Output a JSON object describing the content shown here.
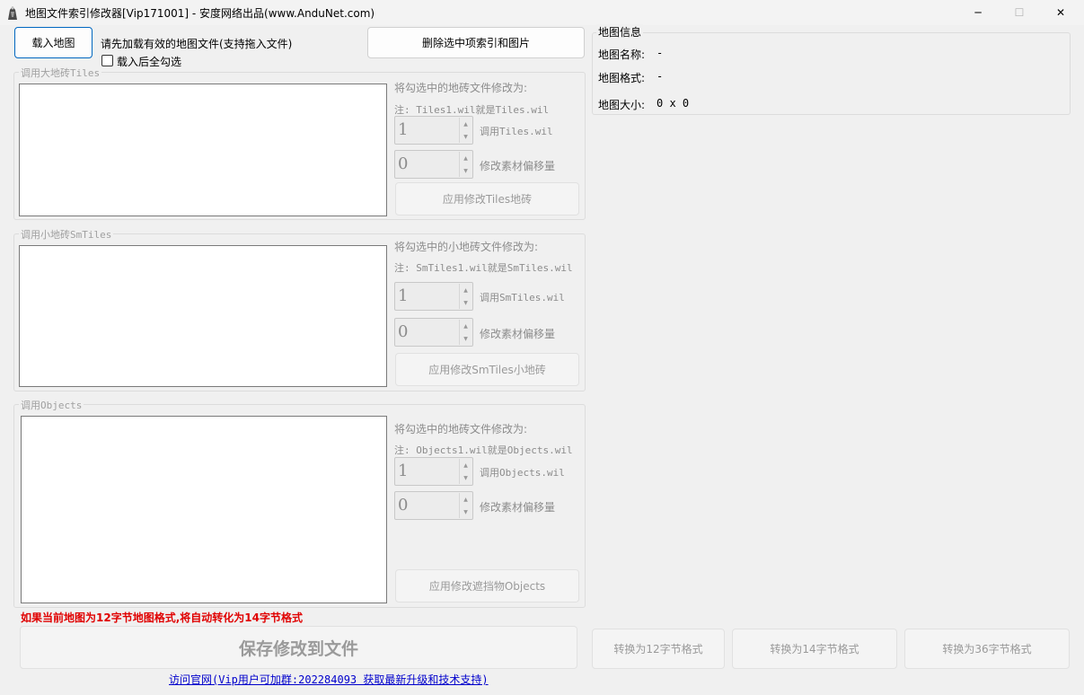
{
  "window": {
    "title": "地图文件索引修改器[Vip171001] - 安度网络出品(www.AnduNet.com)",
    "minimize_glyph": "─",
    "maximize_glyph": "☐",
    "close_glyph": "✕"
  },
  "toolbar": {
    "load_map_label": "载入地图",
    "hint_text": "请先加载有效的地图文件(支持拖入文件)",
    "select_all_after_load_label": "载入后全勾选",
    "delete_selected_label": "删除选中项索引和图片"
  },
  "tiles": {
    "group_title": "调用大地砖Tiles",
    "modify_title": "将勾选中的地砖文件修改为:",
    "note": "注: Tiles1.wil就是Tiles.wil",
    "index_value": "1",
    "index_label": "调用Tiles.wil",
    "offset_value": "0",
    "offset_label": "修改素材偏移量",
    "apply_label": "应用修改Tiles地砖"
  },
  "smtiles": {
    "group_title": "调用小地砖SmTiles",
    "modify_title": "将勾选中的小地砖文件修改为:",
    "note": "注: SmTiles1.wil就是SmTiles.wil",
    "index_value": "1",
    "index_label": "调用SmTiles.wil",
    "offset_value": "0",
    "offset_label": "修改素材偏移量",
    "apply_label": "应用修改SmTiles小地砖"
  },
  "objects": {
    "group_title": "调用Objects",
    "modify_title": "将勾选中的地砖文件修改为:",
    "note": "注: Objects1.wil就是Objects.wil",
    "index_value": "1",
    "index_label": "调用Objects.wil",
    "offset_value": "0",
    "offset_label": "修改素材偏移量",
    "apply_label": "应用修改遮挡物Objects"
  },
  "map_info": {
    "group_title": "地图信息",
    "name_label": "地图名称:",
    "name_value": "-",
    "format_label": "地图格式:",
    "format_value": "-",
    "size_label": "地图大小:",
    "size_value": "0 x 0"
  },
  "footer": {
    "warning": "如果当前地图为12字节地图格式,将自动转化为14字节格式",
    "save_label": "保存修改到文件",
    "convert_12_label": "转换为12字节格式",
    "convert_14_label": "转换为14字节格式",
    "convert_36_label": "转换为36字节格式",
    "visit_link": "访问官网(Vip用户可加群:202284093 获取最新升级和技术支持)"
  },
  "colors": {
    "warning": "#e00000",
    "link": "#0000cc",
    "accent_border": "#0067c0"
  }
}
